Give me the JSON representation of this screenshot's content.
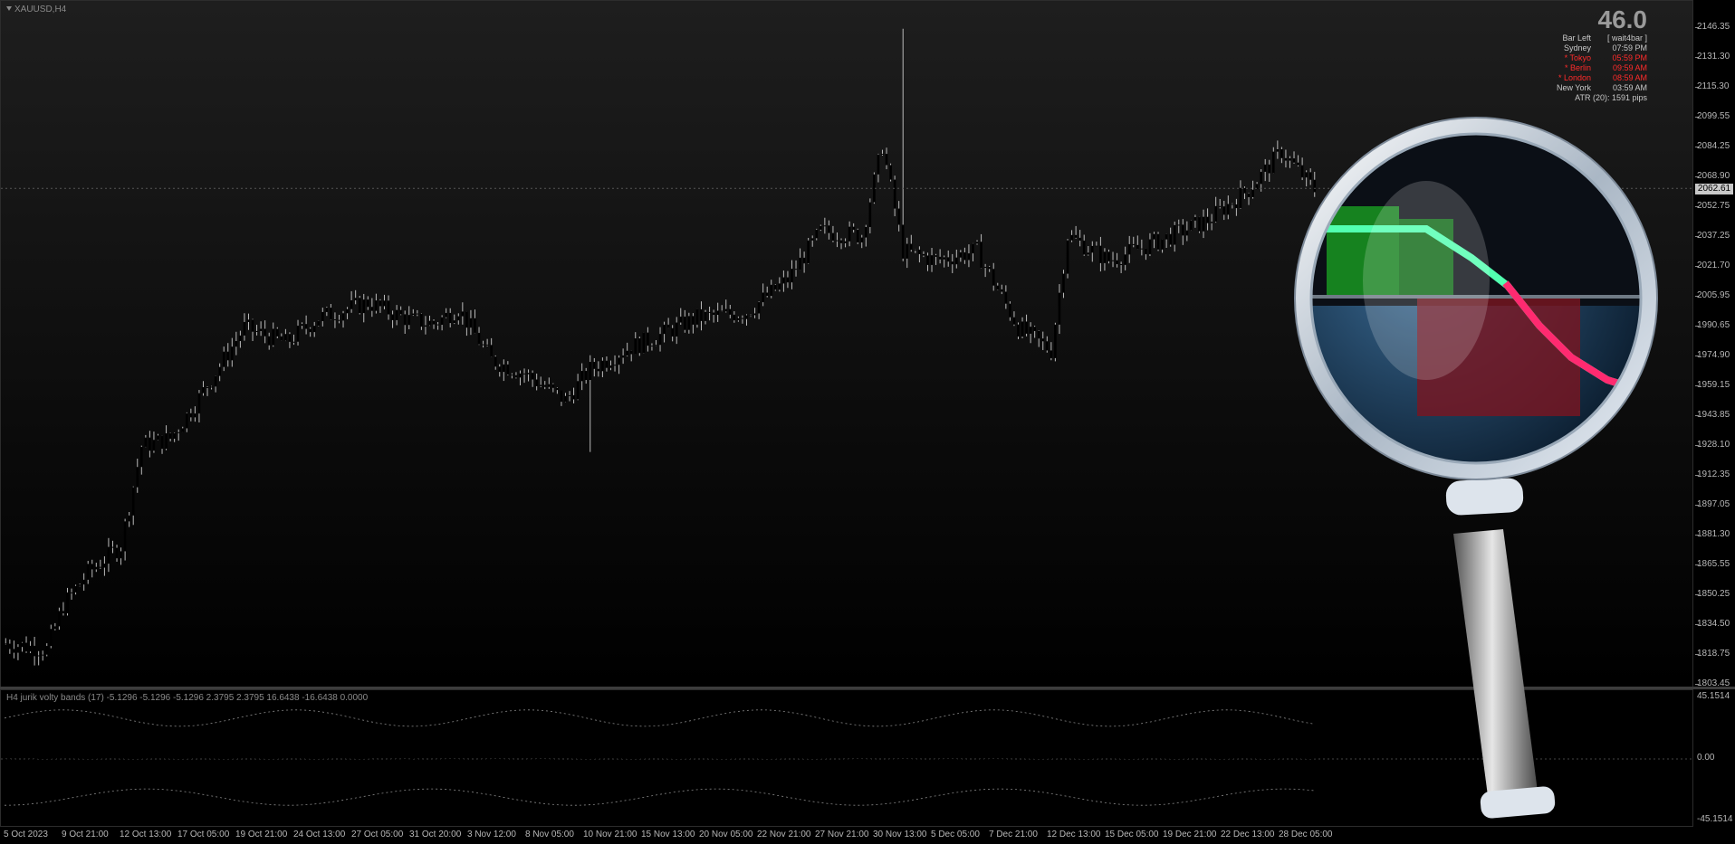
{
  "window": {
    "symbol_label": "XAUUSD,H4"
  },
  "info_panel": {
    "big_value": "46.0",
    "rows": [
      {
        "key": "Bar Left",
        "value": "[ wait4bar ]",
        "color": "#c8c8c8"
      },
      {
        "key": "Sydney",
        "value": "07:59 PM",
        "color": "#c8c8c8"
      },
      {
        "key": "* Tokyo",
        "value": "05:59 PM",
        "color": "#ff2b2b"
      },
      {
        "key": "* Berlin",
        "value": "09:59 AM",
        "color": "#ff2b2b"
      },
      {
        "key": "* London",
        "value": "08:59 AM",
        "color": "#ff2b2b"
      },
      {
        "key": "New York",
        "value": "03:59 AM",
        "color": "#c8c8c8"
      }
    ],
    "atr_text": "ATR (20): 1591 pips"
  },
  "price_axis": {
    "labels": [
      "2146.35",
      "2131.30",
      "2115.30",
      "2099.55",
      "2084.25",
      "2068.90",
      "2052.75",
      "2037.25",
      "2021.70",
      "2005.95",
      "1990.65",
      "1974.90",
      "1959.15",
      "1943.85",
      "1928.10",
      "1912.35",
      "1897.05",
      "1881.30",
      "1865.55",
      "1850.25",
      "1834.50",
      "1818.75",
      "1803.45"
    ],
    "current_price": "2062.61"
  },
  "indicator": {
    "label": "H4 jurik volty bands  (17) -5.1296 -5.1296 -5.1296 2.3795 2.3795 16.6438 -16.6438 0.0000",
    "axis_labels": [
      "45.1514",
      "0.00",
      "-45.1514"
    ]
  },
  "time_axis": {
    "labels": [
      "5 Oct 2023",
      "9 Oct 21:00",
      "12 Oct 13:00",
      "17 Oct 05:00",
      "19 Oct 21:00",
      "24 Oct 13:00",
      "27 Oct 05:00",
      "31 Oct 20:00",
      "3 Nov 12:00",
      "8 Nov 05:00",
      "10 Nov 21:00",
      "15 Nov 13:00",
      "20 Nov 05:00",
      "22 Nov 21:00",
      "27 Nov 21:00",
      "30 Nov 13:00",
      "5 Dec 05:00",
      "7 Dec 21:00",
      "12 Dec 13:00",
      "15 Dec 05:00",
      "19 Dec 21:00",
      "22 Dec 13:00",
      "28 Dec 05:00"
    ]
  },
  "chart_data": {
    "type": "candlestick",
    "ylim": [
      1803.45,
      2146.35
    ],
    "waypoints": [
      [
        0,
        1825
      ],
      [
        10,
        1822
      ],
      [
        14,
        1845
      ],
      [
        20,
        1862
      ],
      [
        28,
        1876
      ],
      [
        33,
        1928
      ],
      [
        40,
        1932
      ],
      [
        46,
        1950
      ],
      [
        58,
        1990
      ],
      [
        68,
        1982
      ],
      [
        76,
        1995
      ],
      [
        88,
        2003
      ],
      [
        98,
        1994
      ],
      [
        104,
        1992
      ],
      [
        110,
        2000
      ],
      [
        118,
        1973
      ],
      [
        126,
        1966
      ],
      [
        136,
        1952
      ],
      [
        142,
        1968
      ],
      [
        150,
        1978
      ],
      [
        158,
        1985
      ],
      [
        168,
        1995
      ],
      [
        180,
        1998
      ],
      [
        190,
        2015
      ],
      [
        198,
        2040
      ],
      [
        208,
        2038
      ],
      [
        213,
        2085
      ],
      [
        218,
        2030
      ],
      [
        226,
        2025
      ],
      [
        236,
        2030
      ],
      [
        246,
        1990
      ],
      [
        254,
        1978
      ],
      [
        258,
        2038
      ],
      [
        268,
        2025
      ],
      [
        280,
        2035
      ],
      [
        292,
        2046
      ],
      [
        302,
        2062
      ],
      [
        310,
        2082
      ],
      [
        318,
        2062
      ]
    ],
    "oscillator_envelope": [
      [
        0,
        -20
      ],
      [
        10,
        5
      ],
      [
        20,
        30
      ],
      [
        30,
        38
      ],
      [
        40,
        35
      ],
      [
        50,
        40
      ],
      [
        56,
        30
      ],
      [
        62,
        12
      ],
      [
        74,
        20
      ],
      [
        82,
        15
      ],
      [
        90,
        -5
      ],
      [
        100,
        0
      ],
      [
        108,
        -12
      ],
      [
        118,
        -20
      ],
      [
        126,
        -15
      ],
      [
        136,
        -5
      ],
      [
        144,
        20
      ],
      [
        152,
        22
      ],
      [
        160,
        15
      ],
      [
        170,
        12
      ],
      [
        180,
        18
      ],
      [
        190,
        25
      ],
      [
        198,
        35
      ],
      [
        206,
        -15
      ],
      [
        212,
        -35
      ],
      [
        220,
        -30
      ],
      [
        228,
        -25
      ],
      [
        238,
        -15
      ],
      [
        242,
        -30
      ],
      [
        248,
        30
      ],
      [
        256,
        35
      ],
      [
        264,
        18
      ],
      [
        274,
        15
      ],
      [
        284,
        20
      ],
      [
        294,
        22
      ],
      [
        304,
        25
      ],
      [
        312,
        15
      ],
      [
        318,
        0
      ]
    ]
  },
  "colors": {
    "bull": "#22e022",
    "bear": "#ff2222",
    "hist_green": "#17a017",
    "hist_red": "#c01010",
    "line_bull": "#40ff90",
    "line_bear": "#ff3060",
    "lens_glass": "#1a3550",
    "ring": "#c7d3e0"
  }
}
